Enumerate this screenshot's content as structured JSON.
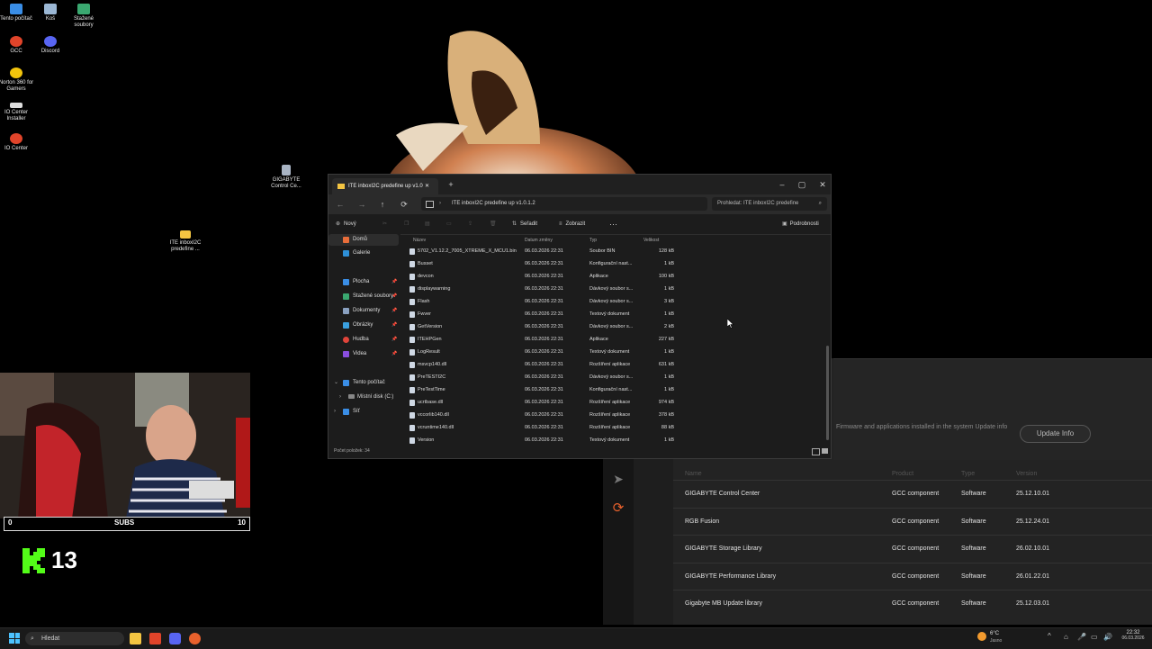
{
  "desktop": {
    "icons": [
      {
        "label": "Tento počítač"
      },
      {
        "label": "Koš"
      },
      {
        "label": "Stažené soubory"
      },
      {
        "label": "GCC"
      },
      {
        "label": "Discord"
      },
      {
        "label": "Norton 360 for Gamers"
      },
      {
        "label": "IO Center Installer"
      },
      {
        "label": "IO Center"
      },
      {
        "label": "GIGABYTE Control Ce..."
      },
      {
        "label": "ITE inboxI2C predefine ..."
      }
    ]
  },
  "explorer": {
    "tab_title": "ITE inboxI2C predefine up v1.0",
    "address": "ITE inboxI2C predefine up v1.0.1.2",
    "search_placeholder": "Prohledat: ITE inboxI2C predefine",
    "toolbar": {
      "new": "Nový",
      "sort": "Seřadit",
      "view": "Zobrazit",
      "more": "···",
      "details": "Podrobnosti"
    },
    "nav": {
      "home": "Domů",
      "gallery": "Galerie",
      "desktop": "Plocha",
      "downloads": "Stažené soubory",
      "documents": "Dokumenty",
      "pictures": "Obrázky",
      "music": "Hudba",
      "videos": "Videa",
      "this_pc": "Tento počítač",
      "local_disk": "Místní disk (C:)",
      "network": "Síť"
    },
    "columns": {
      "name": "Název",
      "date": "Datum změny",
      "type": "Typ",
      "size": "Velikost"
    },
    "files": [
      {
        "name": "5702_V1.12.2_7005_XTREME_X_MCU1.bin",
        "date": "06.03.2026 22:31",
        "type": "Soubor BIN",
        "size": "128 kB"
      },
      {
        "name": "Busset",
        "date": "06.03.2026 22:31",
        "type": "Konfigurační nast...",
        "size": "1 kB"
      },
      {
        "name": "devcon",
        "date": "06.03.2026 22:31",
        "type": "Aplikace",
        "size": "100 kB"
      },
      {
        "name": "displaywarning",
        "date": "06.03.2026 22:31",
        "type": "Dávkový soubor s...",
        "size": "1 kB"
      },
      {
        "name": "Flash",
        "date": "06.03.2026 22:31",
        "type": "Dávkový soubor s...",
        "size": "3 kB"
      },
      {
        "name": "Fwver",
        "date": "06.03.2026 22:31",
        "type": "Textový dokument",
        "size": "1 kB"
      },
      {
        "name": "GetVersion",
        "date": "06.03.2026 22:31",
        "type": "Dávkový soubor s...",
        "size": "2 kB"
      },
      {
        "name": "ITEHPGen",
        "date": "06.03.2026 22:31",
        "type": "Aplikace",
        "size": "227 kB"
      },
      {
        "name": "LogResult",
        "date": "06.03.2026 22:31",
        "type": "Textový dokument",
        "size": "1 kB"
      },
      {
        "name": "msvcp140.dll",
        "date": "06.03.2026 22:31",
        "type": "Rozšíření aplikace",
        "size": "631 kB"
      },
      {
        "name": "PreTESTI2C",
        "date": "06.03.2026 22:31",
        "type": "Dávkový soubor s...",
        "size": "1 kB"
      },
      {
        "name": "PreTestTime",
        "date": "06.03.2026 22:31",
        "type": "Konfigurační nast...",
        "size": "1 kB"
      },
      {
        "name": "ucrtbase.dll",
        "date": "06.03.2026 22:31",
        "type": "Rozšíření aplikace",
        "size": "974 kB"
      },
      {
        "name": "vccorlib140.dll",
        "date": "06.03.2026 22:31",
        "type": "Rozšíření aplikace",
        "size": "378 kB"
      },
      {
        "name": "vcruntime140.dll",
        "date": "06.03.2026 22:31",
        "type": "Rozšíření aplikace",
        "size": "88 kB"
      },
      {
        "name": "Version",
        "date": "06.03.2026 22:31",
        "type": "Textový dokument",
        "size": "1 kB"
      }
    ],
    "status": "Počet položek: 34"
  },
  "gcc": {
    "description": "Firmware and applications installed in the system Update info",
    "update_button": "Update Info",
    "columns": {
      "name": "Name",
      "product": "Product",
      "type": "Type",
      "version": "Version"
    },
    "rows": [
      {
        "name": "GIGABYTE Control Center",
        "product": "GCC component",
        "type": "Software",
        "version": "25.12.10.01"
      },
      {
        "name": "RGB Fusion",
        "product": "GCC component",
        "type": "Software",
        "version": "25.12.24.01"
      },
      {
        "name": "GIGABYTE Storage Library",
        "product": "GCC component",
        "type": "Software",
        "version": "26.02.10.01"
      },
      {
        "name": "GIGABYTE Performance Library",
        "product": "GCC component",
        "type": "Software",
        "version": "26.01.22.01"
      },
      {
        "name": "Gigabyte MB Update library",
        "product": "GCC component",
        "type": "Software",
        "version": "25.12.03.01"
      }
    ]
  },
  "stream": {
    "subs_left": "0",
    "subs_label": "SUBS",
    "subs_right": "10",
    "kick_count": "13",
    "kick_logo_color": "#53fc18"
  },
  "taskbar": {
    "search": "Hledat",
    "weather_temp": "6°C",
    "weather_desc": "Jasno",
    "time": "22:32",
    "date": "06.03.2026"
  }
}
